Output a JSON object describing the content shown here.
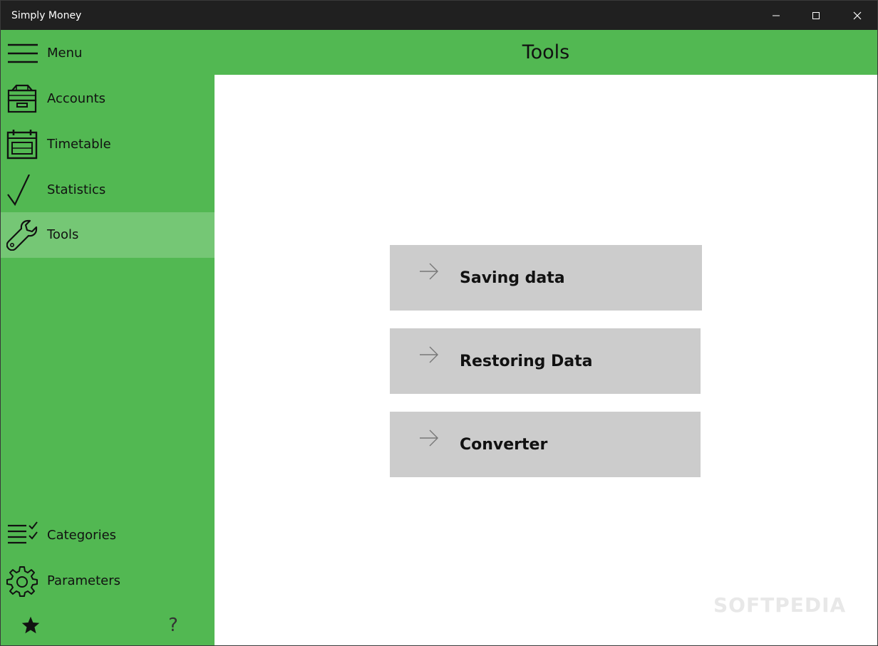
{
  "window": {
    "title": "Simply Money"
  },
  "sidebar": {
    "items": [
      {
        "label": "Menu",
        "icon": "hamburger-icon"
      },
      {
        "label": "Accounts",
        "icon": "accounts-drawer-icon"
      },
      {
        "label": "Timetable",
        "icon": "calendar-icon"
      },
      {
        "label": "Statistics",
        "icon": "checkmark-icon"
      },
      {
        "label": "Tools",
        "icon": "wrench-icon",
        "active": true
      }
    ],
    "bottom_items": [
      {
        "label": "Categories",
        "icon": "checklist-icon"
      },
      {
        "label": "Parameters",
        "icon": "gear-icon"
      }
    ],
    "footer": {
      "favorite_icon": "star-icon",
      "help_glyph": "?"
    }
  },
  "header": {
    "title": "Tools"
  },
  "tools": [
    {
      "label": "Saving data",
      "icon": "arrow-right-icon"
    },
    {
      "label": "Restoring Data",
      "icon": "arrow-right-icon"
    },
    {
      "label": "Converter",
      "icon": "arrow-right-icon"
    }
  ],
  "watermark": "SOFTPEDIA",
  "colors": {
    "accent_green": "#52b852",
    "active_item": "#75c775",
    "tool_button": "#cccccc",
    "titlebar": "#202020"
  }
}
